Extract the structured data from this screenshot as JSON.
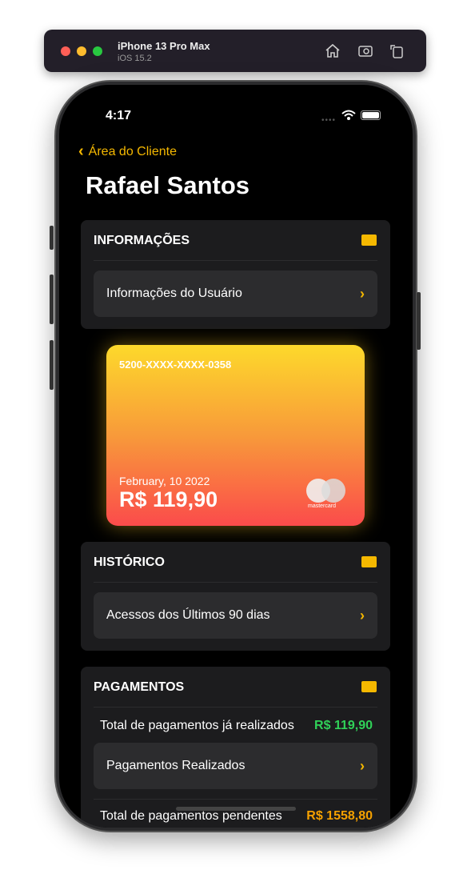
{
  "simulator": {
    "device": "iPhone 13 Pro Max",
    "os": "iOS 15.2"
  },
  "status": {
    "time": "4:17"
  },
  "nav": {
    "back_label": "Área do Cliente",
    "title": "Rafael Santos"
  },
  "info": {
    "header": "INFORMAÇÕES",
    "icon": "person-card-icon",
    "row": "Informações do Usuário"
  },
  "card": {
    "number": "5200-XXXX-XXXX-0358",
    "date": "February, 10 2022",
    "amount": "R$ 119,90",
    "brand": "mastercard"
  },
  "history": {
    "header": "HISTÓRICO",
    "icon": "list-icon",
    "row": "Acessos dos Últimos 90 dias"
  },
  "payments": {
    "header": "PAGAMENTOS",
    "icon": "credit-card-icon",
    "paid_label": "Total de pagamentos já realizados",
    "paid_value": "R$ 119,90",
    "row": "Pagamentos Realizados",
    "pending_label": "Total de pagamentos pendentes",
    "pending_value": "R$ 1558,80"
  },
  "colors": {
    "accent": "#f5b800",
    "paid": "#30d158",
    "pending": "#f5a000"
  }
}
